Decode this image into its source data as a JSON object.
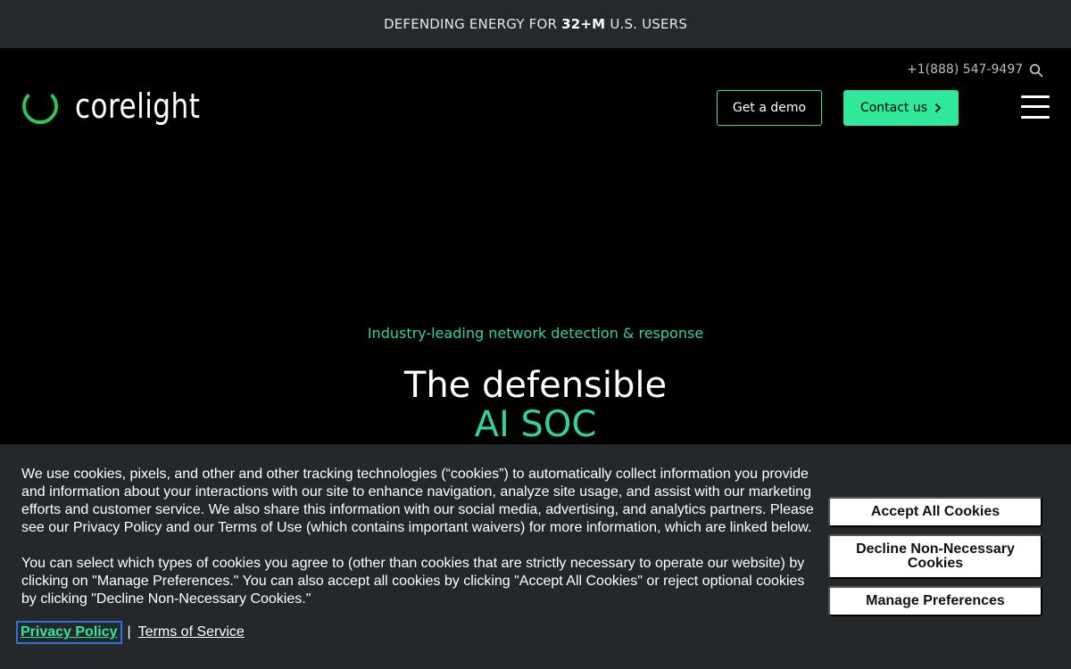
{
  "announcement": {
    "prefix": "DEFENDING ENERGY FOR",
    "highlight": "32+M",
    "suffix": "U.S. USERS"
  },
  "header": {
    "logo_text": "corelight",
    "phone": "+1(888) 547-9497",
    "search_icon": "search-icon",
    "demo_label": "Get a demo",
    "contact_label": "Contact us",
    "menu_icon": "hamburger-menu-icon"
  },
  "hero": {
    "eyebrow": "Industry-leading network detection & response",
    "title_line1": "The defensible",
    "title_line2": "AI SOC"
  },
  "cookie_banner": {
    "paragraph1": "We use cookies, pixels, and other and other tracking technologies (“cookies”) to automatically collect information you provide and information about your interactions with our site to enhance navigation, analyze site usage, and assist with our marketing efforts and customer service. We also share this information with our social media, advertising, and analytics partners. Please see our Privacy Policy and our Terms of Use (which contains important waivers) for more information, which are linked below.",
    "paragraph2": "You can select which types of cookies you agree to (other than cookies that are strictly necessary to operate our website) by clicking on \"Manage Preferences.\" You can also accept all cookies by clicking \"Accept All Cookies\" or reject optional cookies by clicking \"Decline Non-Necessary Cookies.\"",
    "privacy_link": "Privacy Policy",
    "separator": "|",
    "terms_link": "Terms of Service",
    "accept_label": "Accept All Cookies",
    "decline_label": "Decline Non-Necessary Cookies",
    "manage_label": "Manage Preferences"
  },
  "colors": {
    "accent": "#2fe89a",
    "hero_accent": "#2fd3a0",
    "announce_bg": "#26292c",
    "banner_bg": "#25282b"
  }
}
